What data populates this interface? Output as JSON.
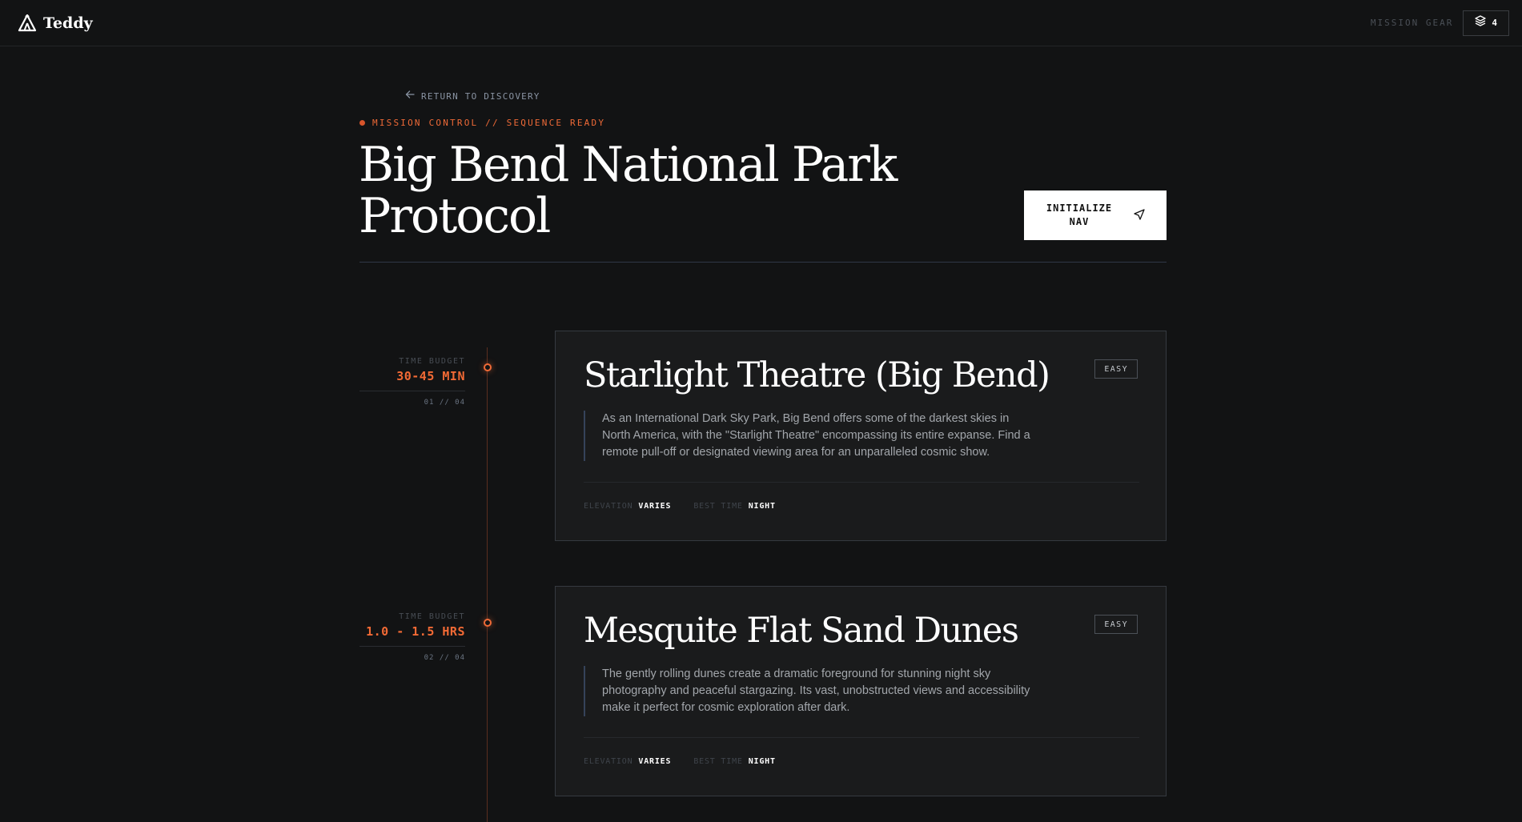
{
  "app": {
    "name": "Teddy",
    "logo_icon": "tent-icon"
  },
  "header": {
    "gear_label": "MISSION GEAR",
    "gear_icon": "layers-icon",
    "gear_count": "4"
  },
  "nav": {
    "back_label": "RETURN TO DISCOVERY",
    "back_icon": "arrow-left-icon"
  },
  "page": {
    "status": "MISSION CONTROL // SEQUENCE READY",
    "title": "Big Bend National Park Protocol",
    "init_button_label": "INITIALIZE NAV",
    "init_button_icon": "navigation-arrow-icon"
  },
  "colors": {
    "background": "#121314",
    "accent": "#ef6a37",
    "card": "#1a1b1c"
  },
  "stops": [
    {
      "time_label": "TIME BUDGET",
      "time_value": "30-45 MIN",
      "step": "01 // 04",
      "title": "Starlight Theatre (Big Bend)",
      "difficulty": "EASY",
      "description": "As an International Dark Sky Park, Big Bend offers some of the darkest skies in North America, with the \"Starlight Theatre\" encompassing its entire expanse. Find a remote pull-off or designated viewing area for an unparalleled cosmic show.",
      "elevation_label": "ELEVATION",
      "elevation_value": "VARIES",
      "best_time_label": "BEST TIME",
      "best_time_value": "NIGHT"
    },
    {
      "time_label": "TIME BUDGET",
      "time_value": "1.0 - 1.5 HRS",
      "step": "02 // 04",
      "title": "Mesquite Flat Sand Dunes",
      "difficulty": "EASY",
      "description": "The gently rolling dunes create a dramatic foreground for stunning night sky photography and peaceful stargazing. Its vast, unobstructed views and accessibility make it perfect for cosmic exploration after dark.",
      "elevation_label": "ELEVATION",
      "elevation_value": "VARIES",
      "best_time_label": "BEST TIME",
      "best_time_value": "NIGHT"
    }
  ]
}
